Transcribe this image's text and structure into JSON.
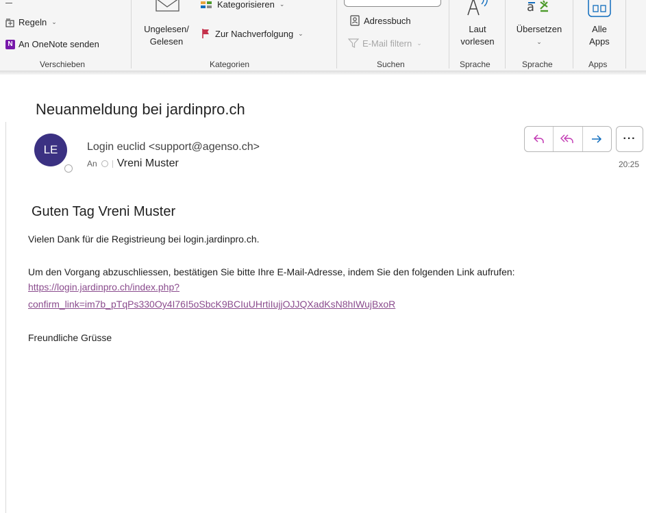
{
  "ribbon": {
    "move_group": {
      "rules_label": "Regeln",
      "onenote_label": "An OneNote senden",
      "group_label": "Verschieben"
    },
    "tags_group": {
      "read_unread_label_line1": "Ungelesen/",
      "read_unread_label_line2": "Gelesen",
      "categorize_label": "Kategorisieren",
      "followup_label": "Zur Nachverfolgung",
      "group_label": "Kategorien"
    },
    "find_group": {
      "address_book_label": "Adressbuch",
      "filter_email_label": "E-Mail filtern",
      "group_label": "Suchen"
    },
    "speech_group": {
      "read_aloud_line1": "Laut",
      "read_aloud_line2": "vorlesen",
      "group_label": "Sprache"
    },
    "language_group": {
      "translate_label": "Übersetzen",
      "group_label": "Sprache"
    },
    "apps_group": {
      "all_apps_line1": "Alle",
      "all_apps_line2": "Apps",
      "group_label": "Apps"
    }
  },
  "message": {
    "subject": "Neuanmeldung bei jardinpro.ch",
    "avatar_initials": "LE",
    "sender": "Login euclid <support@agenso.ch>",
    "to_label": "An",
    "recipient": "Vreni Muster",
    "time": "20:25",
    "colors": {
      "avatar": "#3b3182",
      "link": "#8a4b8d",
      "reply_icons": "#c239b3",
      "forward_icon": "#0f6cbd"
    }
  },
  "body": {
    "greeting": "Guten Tag Vreni Muster",
    "thanks": "Vielen Dank für die Registrieung bei login.jardinpro.ch.",
    "instruction": "Um den Vorgang abzuschliessen, bestätigen Sie bitte Ihre E-Mail-Adresse, indem Sie den folgenden Link aufrufen:",
    "link_line1": "https://login.jardinpro.ch/index.php?",
    "link_line2": "confirm_link=im7b_pTqPs330Oy4I76I5oSbcK9BCIuUHrtiIujjOJJQXadKsN8hIWujBxoR",
    "closing": "Freundliche Grüsse"
  }
}
